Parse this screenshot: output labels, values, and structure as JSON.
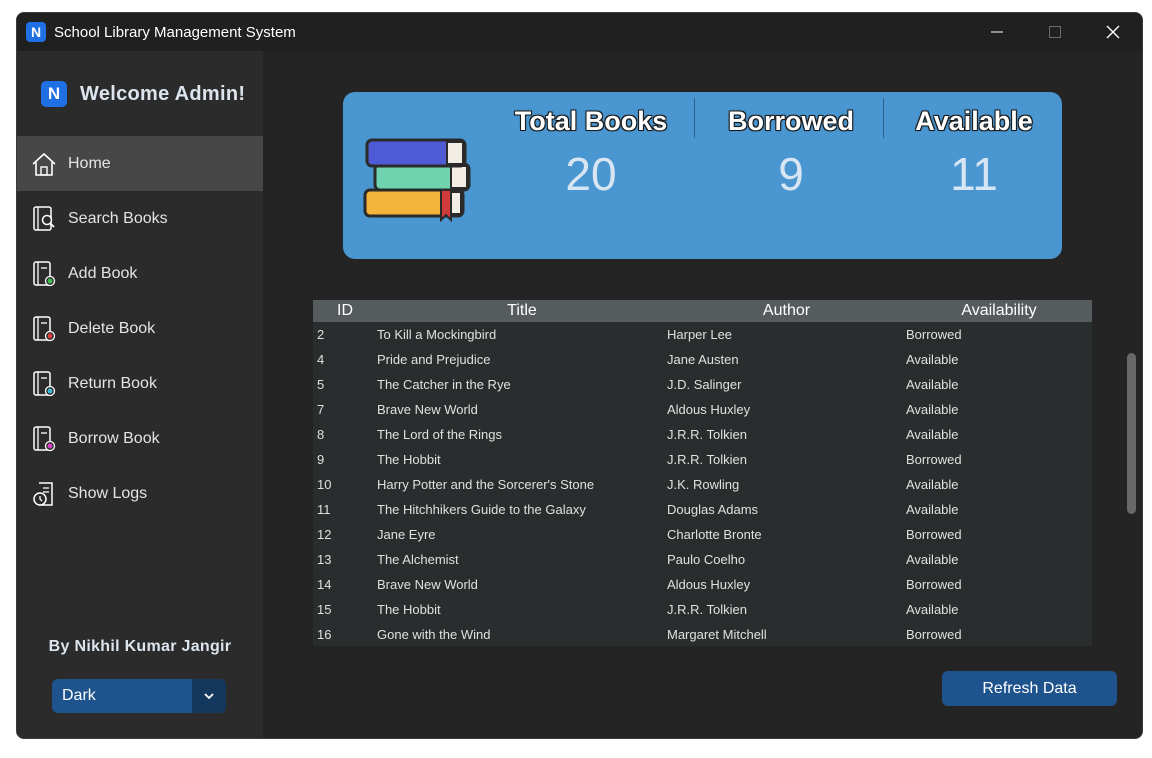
{
  "window": {
    "title": "School Library Management System",
    "app_icon_letter": "N"
  },
  "sidebar": {
    "brand_letter": "N",
    "welcome": "Welcome Admin!",
    "items": [
      {
        "label": "Home",
        "icon": "home-icon",
        "active": true
      },
      {
        "label": "Search Books",
        "icon": "search-book-icon"
      },
      {
        "label": "Add Book",
        "icon": "add-book-icon"
      },
      {
        "label": "Delete Book",
        "icon": "delete-book-icon"
      },
      {
        "label": "Return Book",
        "icon": "return-book-icon"
      },
      {
        "label": "Borrow Book",
        "icon": "borrow-book-icon"
      },
      {
        "label": "Show Logs",
        "icon": "logs-icon"
      }
    ],
    "author": "By Nikhil Kumar Jangir",
    "theme": "Dark"
  },
  "stats": {
    "total_label": "Total Books",
    "total_value": "20",
    "borrowed_label": "Borrowed",
    "borrowed_value": "9",
    "available_label": "Available",
    "available_value": "11"
  },
  "table": {
    "headers": [
      "ID",
      "Title",
      "Author",
      "Availability"
    ],
    "rows": [
      [
        "2",
        "To Kill a Mockingbird",
        "Harper Lee",
        "Borrowed"
      ],
      [
        "4",
        "Pride and Prejudice",
        "Jane Austen",
        "Available"
      ],
      [
        "5",
        "The Catcher in the Rye",
        "J.D. Salinger",
        "Available"
      ],
      [
        "7",
        "Brave New World",
        "Aldous Huxley",
        "Available"
      ],
      [
        "8",
        "The Lord of the Rings",
        "J.R.R. Tolkien",
        "Available"
      ],
      [
        "9",
        "The Hobbit",
        "J.R.R. Tolkien",
        "Borrowed"
      ],
      [
        "10",
        "Harry Potter and the Sorcerer's Stone",
        "J.K. Rowling",
        "Available"
      ],
      [
        "11",
        "The Hitchhikers Guide to the Galaxy",
        "Douglas Adams",
        "Available"
      ],
      [
        "12",
        "Jane Eyre",
        "Charlotte Bronte",
        "Borrowed"
      ],
      [
        "13",
        "The Alchemist",
        "Paulo Coelho",
        "Available"
      ],
      [
        "14",
        "Brave New World",
        "Aldous Huxley",
        "Borrowed"
      ],
      [
        "15",
        "The Hobbit",
        "J.R.R. Tolkien",
        "Available"
      ],
      [
        "16",
        "Gone with the Wind",
        "Margaret Mitchell",
        "Borrowed"
      ]
    ]
  },
  "refresh_label": "Refresh Data",
  "colors": {
    "accent": "#1f538d",
    "card": "#4a96d0",
    "brand": "#1f6fe5"
  }
}
